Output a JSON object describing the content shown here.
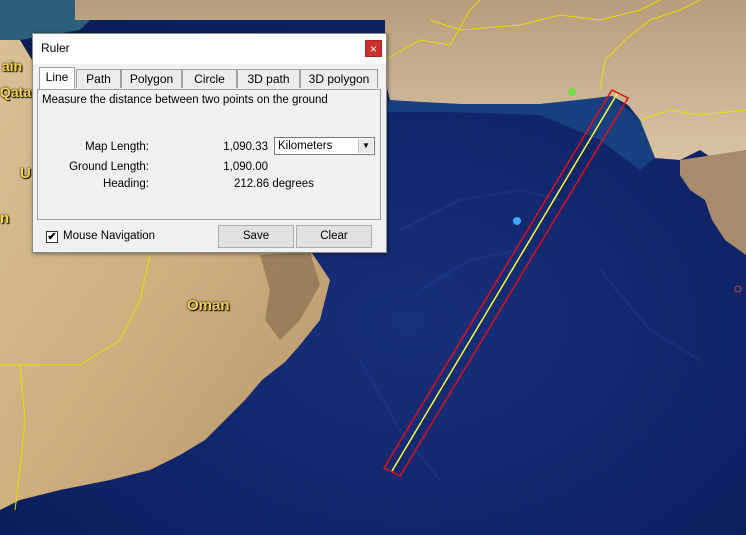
{
  "map": {
    "labels": {
      "qatar_partial": "Qatar",
      "u_partial": "U",
      "n_partial": "n",
      "ain_partial": "ain",
      "oman": "Oman"
    },
    "colors": {
      "ocean": "#0d1f63",
      "land": "#d6b98e",
      "border": "#e8e000",
      "measure_box": "#e0101a",
      "measure_line": "#ffff3a"
    }
  },
  "dialog": {
    "title": "Ruler",
    "close_glyph": "×",
    "tabs": [
      "Line",
      "Path",
      "Polygon",
      "Circle",
      "3D path",
      "3D polygon"
    ],
    "active_tab": "Line",
    "description": "Measure the distance between two points on the ground",
    "map_length": {
      "label": "Map Length:",
      "value": "1,090.33",
      "unit": "Kilometers"
    },
    "ground_length": {
      "label": "Ground Length:",
      "value": "1,090.00"
    },
    "heading": {
      "label": "Heading:",
      "value": "212.86 degrees"
    },
    "mouse_navigation": {
      "label": "Mouse Navigation",
      "checked": true,
      "check_glyph": "✔"
    },
    "save_label": "Save",
    "clear_label": "Clear",
    "dropdown_glyph": "▼"
  }
}
